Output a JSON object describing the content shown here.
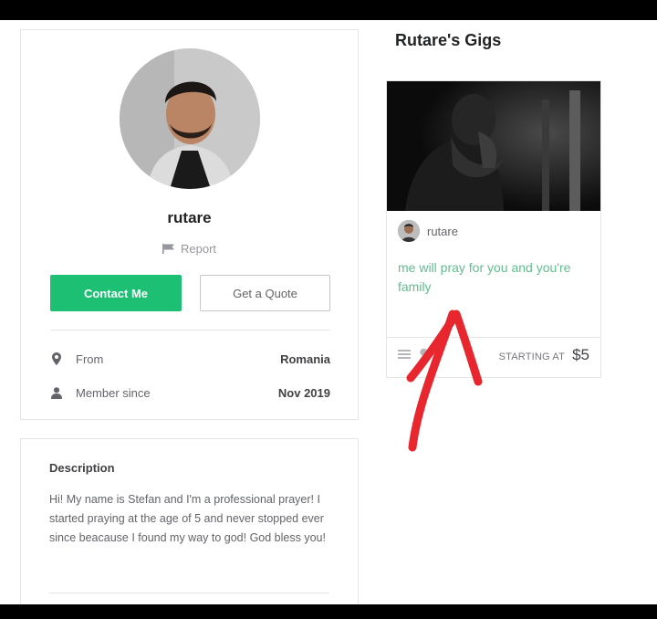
{
  "profile": {
    "username": "rutare",
    "report_label": "Report",
    "contact_button": "Contact Me",
    "quote_button": "Get a Quote",
    "stats": [
      {
        "label": "From",
        "value": "Romania",
        "icon": "location-pin-icon"
      },
      {
        "label": "Member since",
        "value": "Nov 2019",
        "icon": "user-icon"
      }
    ]
  },
  "description": {
    "title": "Description",
    "text": "Hi! My name is Stefan and I'm a professional prayer! I started praying at the age of 5 and never stopped ever since beacause I found my way to god! God bless you!"
  },
  "gigs": {
    "section_title": "Rutare's Gigs",
    "items": [
      {
        "seller": "rutare",
        "title": "me will pray for you and you're family",
        "starting_label": "STARTING AT",
        "price": "$5"
      }
    ]
  },
  "colors": {
    "accent": "#1dbf73",
    "gig_title": "#62bd8f",
    "annotation_arrow": "#e8262e"
  }
}
